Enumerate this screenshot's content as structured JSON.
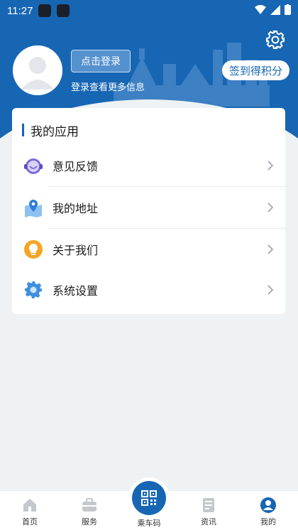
{
  "status_bar": {
    "time": "11:27"
  },
  "header": {
    "login_button": "点击登录",
    "login_hint": "登录查看更多信息",
    "signin_button": "签到得积分"
  },
  "my_apps": {
    "title": "我的应用",
    "items": [
      {
        "label": "意见反馈",
        "icon": "feedback-headset-icon",
        "color": "#7b6ad8"
      },
      {
        "label": "我的地址",
        "icon": "map-pin-icon",
        "color": "#3d8fe0"
      },
      {
        "label": "关于我们",
        "icon": "lightbulb-icon",
        "color": "#f3a523"
      },
      {
        "label": "系统设置",
        "icon": "gear-icon",
        "color": "#3d8fe0"
      }
    ]
  },
  "bottom_nav": {
    "items": [
      {
        "label": "首页",
        "icon": "home-icon"
      },
      {
        "label": "服务",
        "icon": "briefcase-icon"
      },
      {
        "label": "乘车码",
        "icon": "qr-code-icon"
      },
      {
        "label": "资讯",
        "icon": "news-icon"
      },
      {
        "label": "我的",
        "icon": "user-icon"
      }
    ]
  },
  "colors": {
    "brand": "#1766b4",
    "background": "#eef2f5"
  }
}
